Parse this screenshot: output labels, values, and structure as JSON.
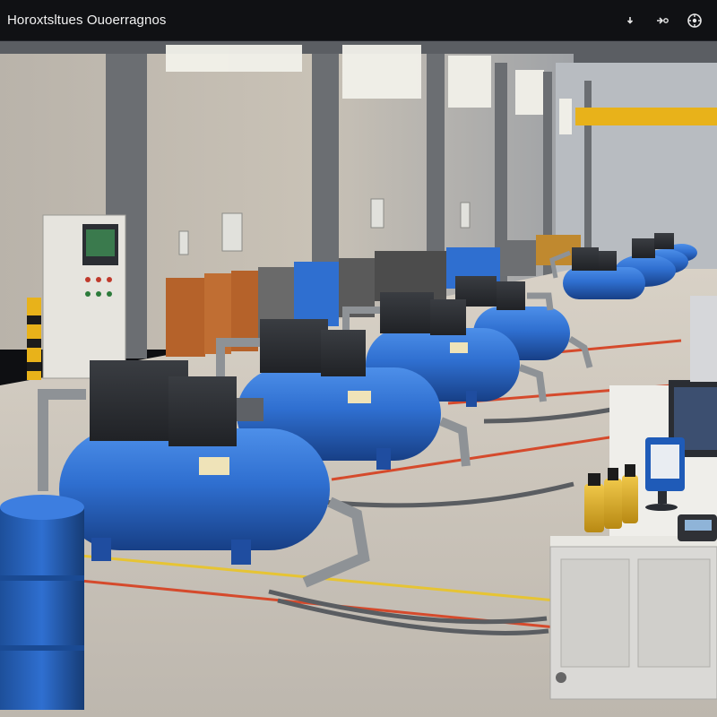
{
  "header": {
    "title": "Horoxtsltues Ouoerragnos",
    "controls": [
      {
        "name": "download-icon"
      },
      {
        "name": "share-icon"
      },
      {
        "name": "settings-icon"
      }
    ]
  },
  "scene": {
    "description_icons": [
      "compressor-unit",
      "oil-bottle",
      "tablet-device",
      "monitor",
      "control-cabinet",
      "blue-drum"
    ]
  },
  "colors": {
    "topbar": "#101114",
    "tank_blue": "#2f6fd0",
    "accent_yellow": "#e8b21a",
    "floor": "#cfcac2"
  }
}
